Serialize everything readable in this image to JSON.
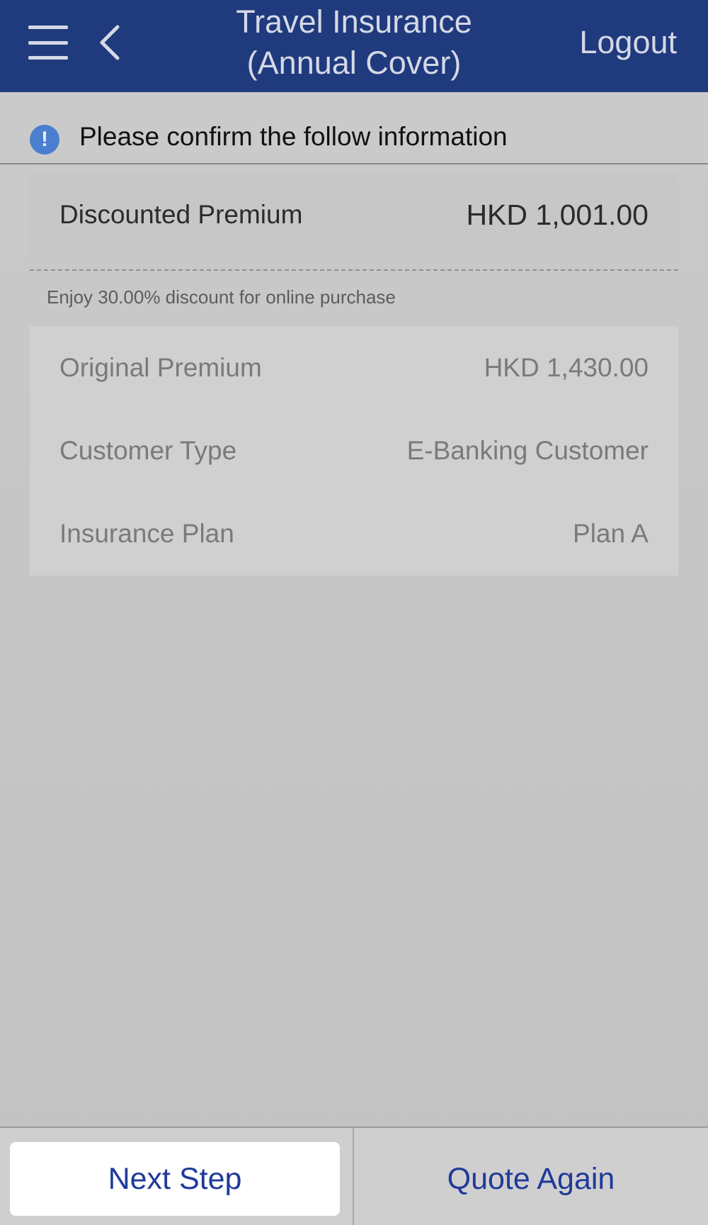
{
  "header": {
    "title_line1": "Travel Insurance",
    "title_line2": "(Annual Cover)",
    "logout_label": "Logout",
    "menu_icon": "hamburger-menu-icon",
    "back_icon": "chevron-left-icon"
  },
  "notice": {
    "icon": "info-exclamation-icon",
    "text": "Please confirm the follow information"
  },
  "premium": {
    "label": "Discounted Premium",
    "value": "HKD 1,001.00",
    "discount_note": "Enjoy 30.00% discount for online purchase"
  },
  "details": [
    {
      "label": "Original Premium",
      "value": "HKD 1,430.00"
    },
    {
      "label": "Customer Type",
      "value": "E-Banking Customer"
    },
    {
      "label": "Insurance Plan",
      "value": "Plan A"
    }
  ],
  "footer": {
    "next_label": "Next Step",
    "quote_label": "Quote Again"
  },
  "colors": {
    "header_bg": "#203a7e",
    "accent_text": "#203a9a",
    "info_icon": "#4a7fd0"
  }
}
